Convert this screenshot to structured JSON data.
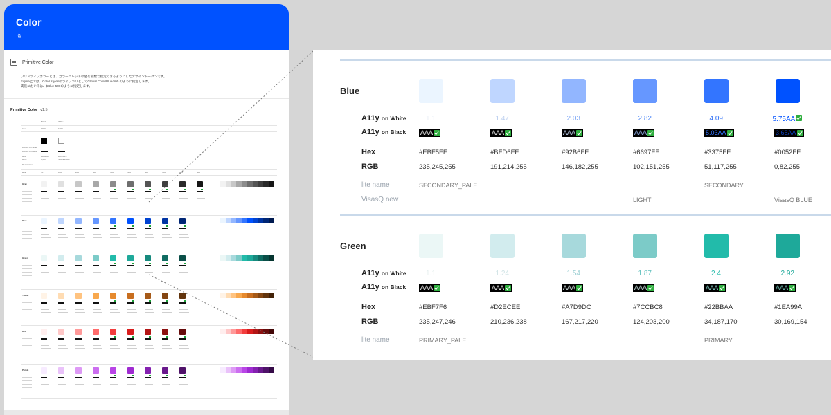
{
  "thumbnail": {
    "title": "Color",
    "subtitle": "色",
    "primitive_color_heading": "Primitive Color",
    "description_lines": [
      "プリミティブカラーとは、カラーパレットの値を変数で指定できるようにしたデザイントークンです。",
      "Figma上では、Color stylesのライブラリとしてGlobal Color/Blue/500 のように指定します。",
      "実装においては、$Blue-500のように指定します。"
    ],
    "table_title": "Primitive Color",
    "table_version": "v1.5",
    "bw_headers": [
      "Black",
      "White"
    ],
    "bw_level_label": "level",
    "bw_levels": [
      "1000",
      "1000"
    ],
    "bw_row_labels": [
      "WCAG on White",
      "WCAG on Black",
      "Hex",
      "RGB",
      "Description"
    ],
    "bw_hex": [
      "#000000",
      "#FFFFFF"
    ],
    "bw_rgb": [
      "0,0,0",
      "255,255,255"
    ],
    "level_header_label": "level",
    "levels": [
      "50",
      "100",
      "200",
      "300",
      "400",
      "500",
      "600",
      "700",
      "800",
      "900"
    ],
    "families": [
      {
        "name": "Gray",
        "colors": [
          "#f2f2f2",
          "#e0e0e0",
          "#c7c7c7",
          "#a8a8a8",
          "#8c8c8c",
          "#6e6e6e",
          "#555555",
          "#3f3f3f",
          "#2a2a2a",
          "#161616"
        ]
      },
      {
        "name": "Blue",
        "colors": [
          "#ebf5ff",
          "#bfd6ff",
          "#92b6ff",
          "#6697ff",
          "#3375ff",
          "#0052ff",
          "#0043d1",
          "#0034a3",
          "#002675",
          "#001a50"
        ]
      },
      {
        "name": "Green",
        "colors": [
          "#ebf7f6",
          "#d2ecee",
          "#a7d9dc",
          "#7ccbc8",
          "#22bbaa",
          "#1ea99a",
          "#178a7e",
          "#106c62",
          "#0a4f48",
          "#063530"
        ]
      },
      {
        "name": "Yellow",
        "colors": [
          "#fff3e6",
          "#ffdcb3",
          "#ffc380",
          "#f8a84d",
          "#e68a2e",
          "#c86e1f",
          "#a65a18",
          "#844612",
          "#62340d",
          "#422208"
        ]
      },
      {
        "name": "Red",
        "colors": [
          "#ffeeee",
          "#ffc7c7",
          "#ff9999",
          "#ff6b6b",
          "#f23d3d",
          "#d91c1c",
          "#b31515",
          "#8c1010",
          "#660b0b",
          "#420707"
        ]
      },
      {
        "name": "Purple",
        "colors": [
          "#f7ebff",
          "#eac2fa",
          "#dd99f5",
          "#cc6ef0",
          "#b845e6",
          "#9f2bd1",
          "#8421b0",
          "#69198c",
          "#4f1269",
          "#350b47"
        ]
      }
    ]
  },
  "zoom": {
    "sections": [
      {
        "name": "Blue",
        "rows": {
          "a11y_white": "A11y",
          "a11y_white_suffix": "on White",
          "a11y_black": "A11y",
          "a11y_black_suffix": "on Black",
          "hex": "Hex",
          "rgb": "RGB",
          "lite": "lite name",
          "visasq": "VisasQ new"
        },
        "swatches": [
          {
            "color": "#EBF5FF",
            "white": "1.1",
            "white_color": "#e8eef6",
            "black_text": "AAA",
            "black_color": "#ffffff",
            "hex": "#EBF5FF",
            "rgb": "235,245,255",
            "lite": "SECONDARY_PALE",
            "visasq": ""
          },
          {
            "color": "#BFD6FF",
            "white": "1.47",
            "white_color": "#b9cdee",
            "black_text": "AAA",
            "black_color": "#ffffff",
            "hex": "#BFD6FF",
            "rgb": "191,214,255",
            "lite": "",
            "visasq": ""
          },
          {
            "color": "#92B6FF",
            "white": "2.03",
            "white_color": "#7ea7f5",
            "black_text": "AAA",
            "black_color": "#cfe0ff",
            "hex": "#92B6FF",
            "rgb": "146,182,255",
            "lite": "",
            "visasq": ""
          },
          {
            "color": "#6697FF",
            "white": "2.82",
            "white_color": "#4f88f7",
            "black_text": "AAA",
            "black_color": "#9fc0ff",
            "hex": "#6697FF",
            "rgb": "102,151,255",
            "lite": "",
            "visasq": "LIGHT"
          },
          {
            "color": "#3375FF",
            "white": "4.09",
            "white_color": "#2f6ff5",
            "black_text": "5.03AA",
            "black_color": "#3375ff",
            "hex": "#3375FF",
            "rgb": "51,117,255",
            "lite": "SECONDARY",
            "visasq": ""
          },
          {
            "color": "#0052FF",
            "white": "5.75AA",
            "white_color": "#0052ff",
            "black_text": "3.65AA",
            "black_color": "#0b3fb8",
            "hex": "#0052FF",
            "rgb": "0,82,255",
            "lite": "",
            "visasq": "VisasQ BLUE"
          }
        ]
      },
      {
        "name": "Green",
        "rows": {
          "a11y_white": "A11y",
          "a11y_white_suffix": "on White",
          "a11y_black": "A11y",
          "a11y_black_suffix": "on Black",
          "hex": "Hex",
          "rgb": "RGB",
          "lite": "lite name"
        },
        "swatches": [
          {
            "color": "#EBF7F6",
            "white": "1.1",
            "white_color": "#e6efee",
            "black_text": "AAA",
            "black_color": "#ffffff",
            "hex": "#EBF7F6",
            "rgb": "235,247,246",
            "lite": "PRIMARY_PALE"
          },
          {
            "color": "#D2ECEE",
            "white": "1.24",
            "white_color": "#cfe3e5",
            "black_text": "AAA",
            "black_color": "#ffffff",
            "hex": "#D2ECEE",
            "rgb": "210,236,238",
            "lite": ""
          },
          {
            "color": "#A7D9DC",
            "white": "1.54",
            "white_color": "#9ccfd3",
            "black_text": "AAA",
            "black_color": "#e8f6f6",
            "hex": "#A7D9DC",
            "rgb": "167,217,220",
            "lite": ""
          },
          {
            "color": "#7CCBC8",
            "white": "1.87",
            "white_color": "#5fc0bd",
            "black_text": "AAA",
            "black_color": "#d5f0ee",
            "hex": "#7CCBC8",
            "rgb": "124,203,200",
            "lite": ""
          },
          {
            "color": "#22BBAA",
            "white": "2.4",
            "white_color": "#22bbaa",
            "black_text": "AAA",
            "black_color": "#8fe0d6",
            "hex": "#22BBAA",
            "rgb": "34,187,170",
            "lite": "PRIMARY"
          },
          {
            "color": "#1EA99A",
            "white": "2.92",
            "white_color": "#1ea99a",
            "black_text": "AAA",
            "black_color": "#7cd4c8",
            "hex": "#1EA99A",
            "rgb": "30,169,154",
            "lite": ""
          }
        ]
      }
    ]
  }
}
